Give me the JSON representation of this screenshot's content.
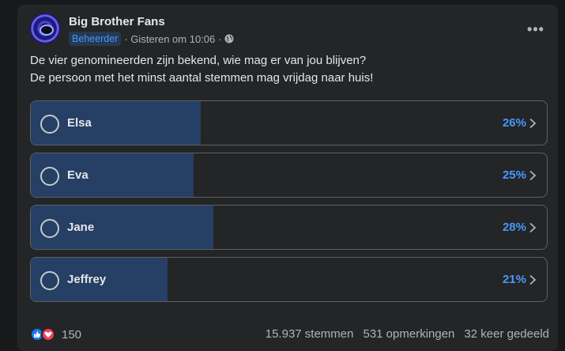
{
  "post": {
    "page_name": "Big Brother Fans",
    "badge": "Beheerder",
    "timestamp": "· Gisteren om 10:06 ·",
    "privacy_icon": "globe-icon",
    "more_icon": "more-icon",
    "more_label": "•••",
    "text_line1": "De vier genomineerden zijn bekend, wie mag er van jou blijven?",
    "text_line2": "De persoon met het minst aantal stemmen mag vrijdag naar huis!"
  },
  "poll": {
    "options": [
      {
        "label": "Elsa",
        "percent_text": "26%",
        "percent": 26
      },
      {
        "label": "Eva",
        "percent_text": "25%",
        "percent": 25
      },
      {
        "label": "Jane",
        "percent_text": "28%",
        "percent": 28
      },
      {
        "label": "Jeffrey",
        "percent_text": "21%",
        "percent": 21
      }
    ]
  },
  "footer": {
    "reaction_icons": [
      "like-icon",
      "love-icon"
    ],
    "reaction_count": "150",
    "votes": "15.937 stemmen",
    "comments": "531 opmerkingen",
    "shares": "32 keer gedeeld"
  },
  "colors": {
    "background": "#18191a",
    "card": "#242526",
    "poll_fill": "#263f64",
    "accent": "#4599ff",
    "like": "#1877f2",
    "love": "#f33e58"
  }
}
